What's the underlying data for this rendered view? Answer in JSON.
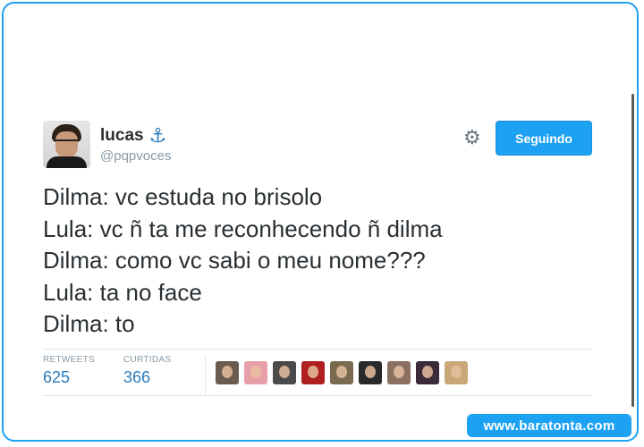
{
  "tweet": {
    "author": {
      "name": "lucas",
      "handle": "@pqpvoces",
      "badge_icon": "anchor-icon"
    },
    "follow_button_label": "Seguindo",
    "settings_icon": "gear-icon",
    "lines": [
      "Dilma: vc estuda no brisolo",
      "Lula: vc ñ ta me reconhecendo ñ dilma",
      "Dilma: como vc sabi o meu nome???",
      "Lula: ta no face",
      "Dilma: to"
    ],
    "stats": {
      "retweets_label": "RETWEETS",
      "retweets_value": "625",
      "likes_label": "CURTIDAS",
      "likes_value": "366"
    },
    "likers": [
      {
        "icon": "avatar",
        "color": "#6b5a4e"
      },
      {
        "icon": "avatar",
        "color": "#e8a0a8"
      },
      {
        "icon": "avatar",
        "color": "#4a4a4a"
      },
      {
        "icon": "avatar",
        "color": "#b02020"
      },
      {
        "icon": "avatar",
        "color": "#7a6a50"
      },
      {
        "icon": "avatar",
        "color": "#2a2a2a"
      },
      {
        "icon": "avatar",
        "color": "#8a7060"
      },
      {
        "icon": "avatar",
        "color": "#3a2a3a"
      },
      {
        "icon": "avatar",
        "color": "#c8a878"
      }
    ]
  },
  "watermark": "www.baratonta.com",
  "colors": {
    "accent": "#1da1f2",
    "link": "#2b7bb9",
    "text": "#292f33",
    "muted": "#8899a6"
  }
}
